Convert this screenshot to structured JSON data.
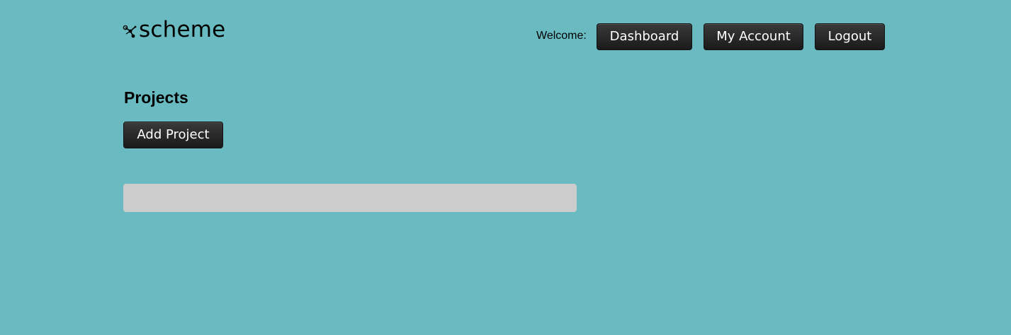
{
  "header": {
    "logo_text": "scheme",
    "welcome_label": "Welcome:",
    "nav": {
      "dashboard_label": "Dashboard",
      "account_label": "My Account",
      "logout_label": "Logout"
    }
  },
  "main": {
    "title": "Projects",
    "add_project_label": "Add Project",
    "projects_list": []
  },
  "colors": {
    "background": "#69bbc1",
    "button": "#222222",
    "button_text": "#ffffff",
    "list_placeholder": "#cdcccd"
  },
  "icons": {
    "logo": "molecule-icon"
  }
}
